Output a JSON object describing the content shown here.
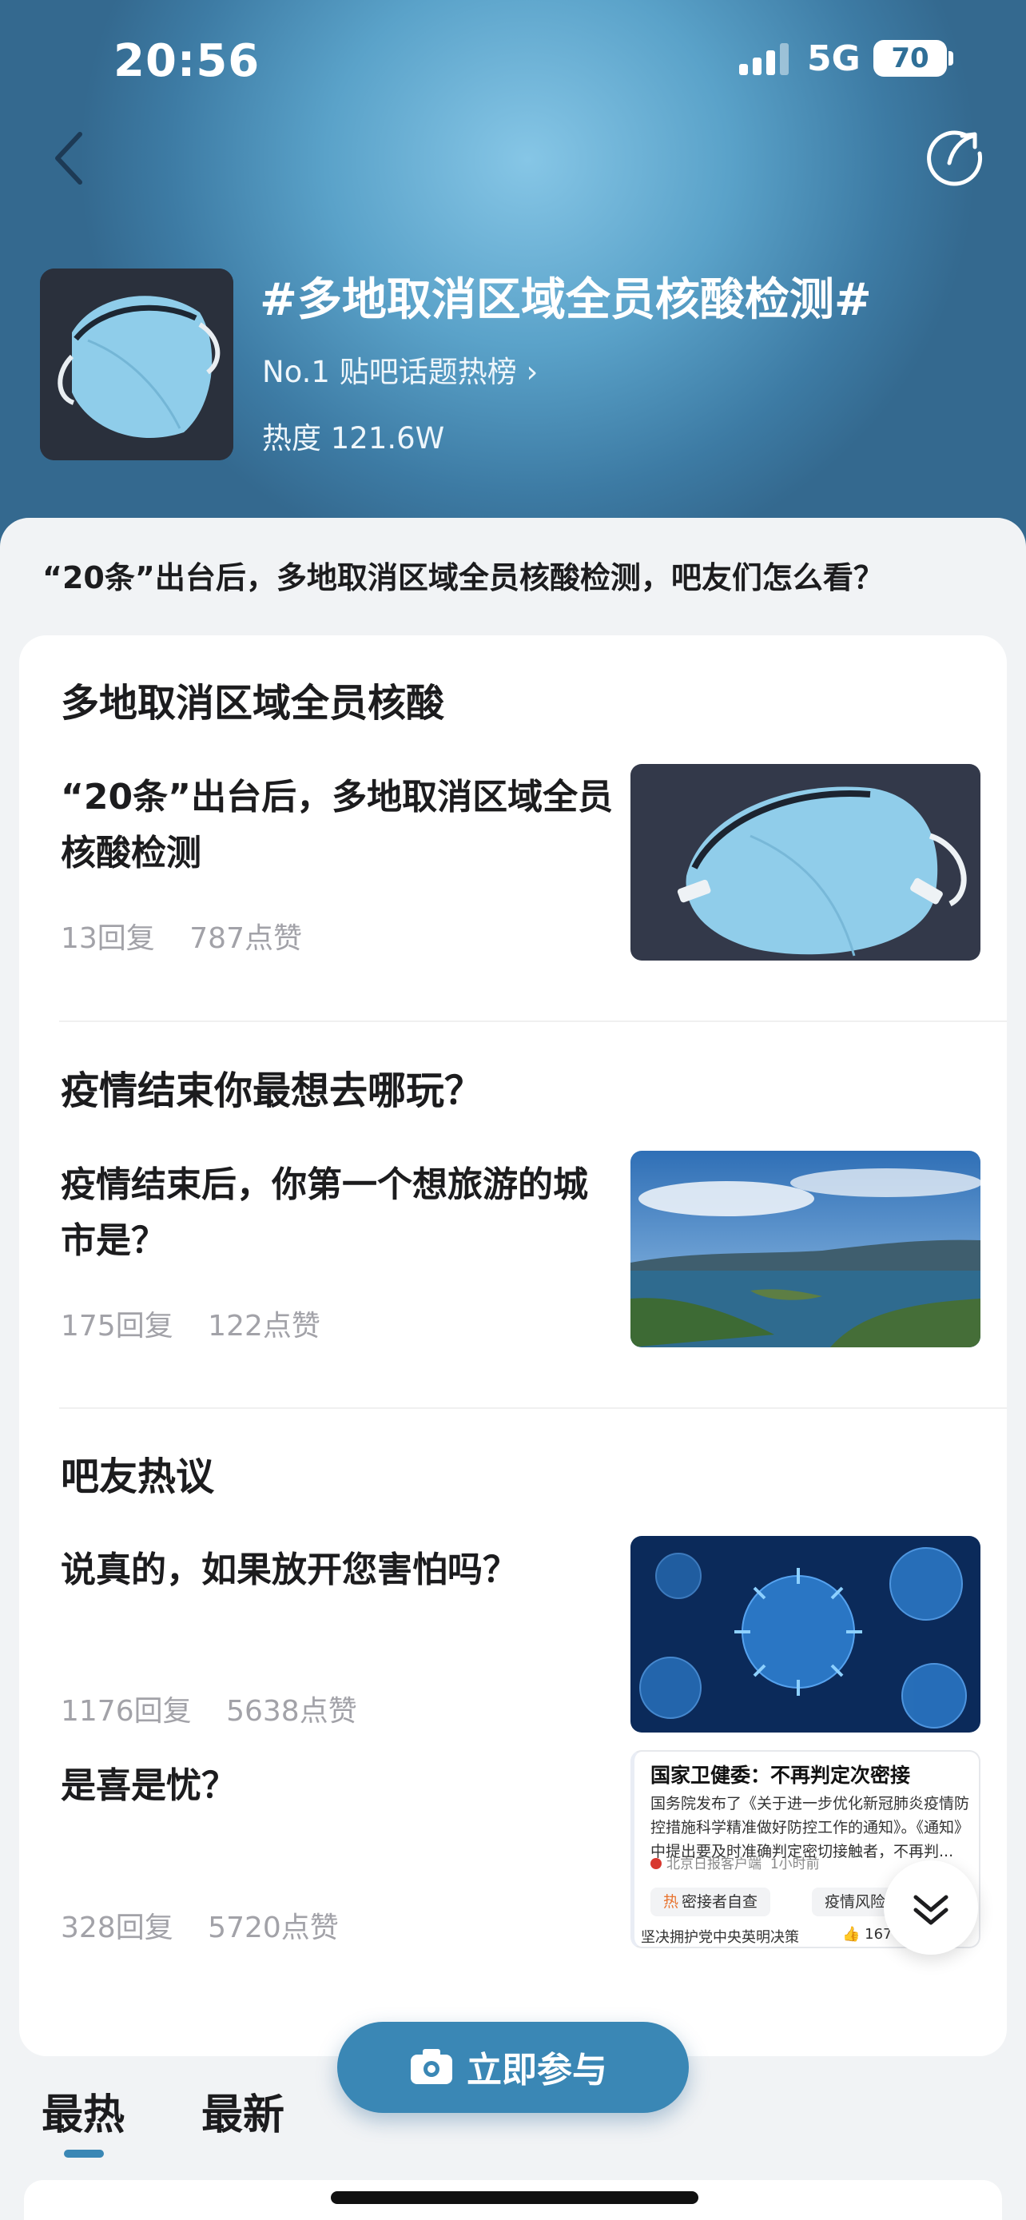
{
  "status_bar": {
    "time": "20:56",
    "network": "5G",
    "battery": "70"
  },
  "topic": {
    "title": "#多地取消区域全员核酸检测#",
    "rank": "No.1 贴吧话题热榜",
    "heat": "热度 121.6W",
    "question": "“20条”出台后，多地取消区域全员核酸检测，吧友们怎么看？"
  },
  "sections": [
    {
      "title": "多地取消区域全员核酸",
      "post": {
        "title": "“20条”出台后，多地取消区域全员核酸检测",
        "replies": "13回复",
        "likes": "787点赞"
      }
    },
    {
      "title": "疫情结束你最想去哪玩？",
      "post": {
        "title": "疫情结束后，你第一个想旅游的城市是？",
        "replies": "175回复",
        "likes": "122点赞"
      }
    },
    {
      "title": "吧友热议",
      "posts": [
        {
          "title": "说真的，如果放开您害怕吗？",
          "replies": "1176回复",
          "likes": "5638点赞"
        },
        {
          "title": "是喜是忧？",
          "replies": "328回复",
          "likes": "5720点赞"
        }
      ]
    }
  ],
  "news_card": {
    "headline": "国家卫健委：不再判定次密接",
    "body": "国务院发布了《关于进一步优化新冠肺炎疫情防控措施科学精准做好防控工作的通知》。《通知》中提出要及时准确判定密切接触者，不再判...",
    "source": "北京日报客户端",
    "time": "1小时前",
    "tags": [
      {
        "badge": "热",
        "label": "密接者自查"
      },
      {
        "label": "疫情风险"
      }
    ],
    "footer": "坚决拥护党中央英明决策",
    "likes": "167"
  },
  "cta_label": "立即参与",
  "tabs": [
    "最热",
    "最新"
  ],
  "colors": {
    "accent": "#3a87b5",
    "header": "#5aa2c9"
  }
}
